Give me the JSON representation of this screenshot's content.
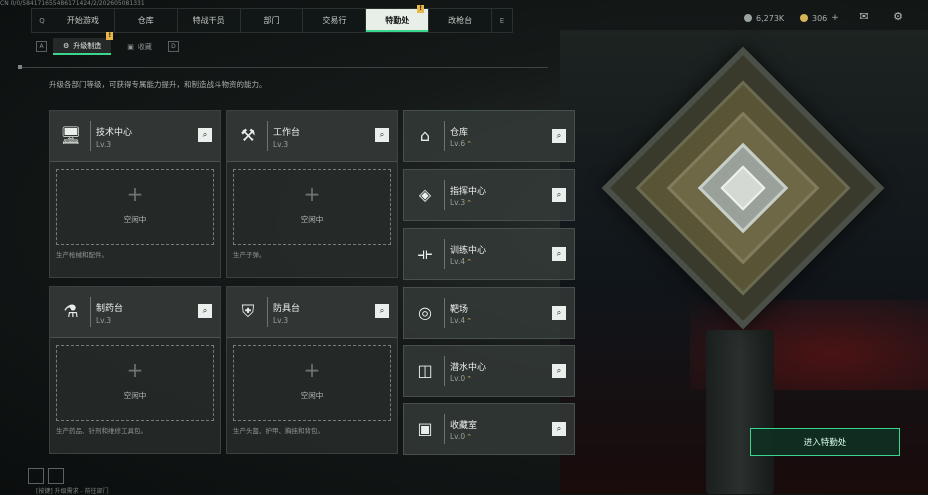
{
  "meta": {
    "build_id": "CN 0/0/584171655486171424/2/202605081331"
  },
  "nav": {
    "left_key": "Q",
    "right_key": "E",
    "tabs": [
      {
        "label": "开始游戏",
        "active": false
      },
      {
        "label": "仓库",
        "active": false
      },
      {
        "label": "特战干员",
        "active": false
      },
      {
        "label": "部门",
        "active": false
      },
      {
        "label": "交易行",
        "active": false
      },
      {
        "label": "特勤处",
        "active": true,
        "badge": "!"
      },
      {
        "label": "改枪台",
        "active": false
      }
    ]
  },
  "resources": {
    "currency": "6,273K",
    "premium": "306"
  },
  "subtabs": {
    "left_key": "A",
    "right_key": "D",
    "items": [
      {
        "label": "升级制造",
        "active": true,
        "badge": "!"
      },
      {
        "label": "收藏",
        "active": false
      }
    ]
  },
  "description": "升级各部门等级，可获得专属能力提升，和制造战斗物资的能力。",
  "cards": [
    {
      "icon": "computer-icon",
      "name": "技术中心",
      "level": "Lv.3",
      "slot_label": "空闲中",
      "desc": "生产枪械和配件。"
    },
    {
      "icon": "tools-icon",
      "name": "工作台",
      "level": "Lv.3",
      "slot_label": "空闲中",
      "desc": "生产子弹。"
    },
    {
      "icon": "microscope-icon",
      "name": "制药台",
      "level": "Lv.3",
      "slot_label": "空闲中",
      "desc": "生产药品、针剂和维修工具包。"
    },
    {
      "icon": "armor-icon",
      "name": "防具台",
      "level": "Lv.3",
      "slot_label": "空闲中",
      "desc": "生产头盔、护甲、胸挂和背包。"
    }
  ],
  "side_rows": [
    {
      "icon": "warehouse-icon",
      "name": "仓库",
      "level": "Lv.6"
    },
    {
      "icon": "command-icon",
      "name": "指挥中心",
      "level": "Lv.3"
    },
    {
      "icon": "dumbbell-icon",
      "name": "训练中心",
      "level": "Lv.4"
    },
    {
      "icon": "target-icon",
      "name": "靶场",
      "level": "Lv.4"
    },
    {
      "icon": "diving-icon",
      "name": "潜水中心",
      "level": "Lv.0"
    },
    {
      "icon": "collection-icon",
      "name": "收藏室",
      "level": "Lv.0"
    }
  ],
  "enter_button": "进入特勤处",
  "footer": "[按键] 升级需求 - 前往部门"
}
